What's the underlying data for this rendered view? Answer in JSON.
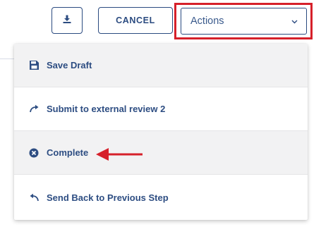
{
  "toolbar": {
    "download_icon": "download-icon",
    "cancel_label": "CANCEL"
  },
  "actions": {
    "label": "Actions",
    "chevron_icon": "chevron-down-icon",
    "highlight_color": "#d6202a"
  },
  "menu": {
    "items": [
      {
        "label": "Save Draft",
        "icon": "save-icon"
      },
      {
        "label": "Submit to external review 2",
        "icon": "redo-arrow-icon"
      },
      {
        "label": "Complete",
        "icon": "x-circle-icon"
      },
      {
        "label": "Send Back to Previous Step",
        "icon": "undo-arrow-icon"
      }
    ]
  },
  "colors": {
    "primary": "#2b4b80",
    "annotation_red": "#d6202a",
    "menu_shade": "#f2f2f3"
  }
}
